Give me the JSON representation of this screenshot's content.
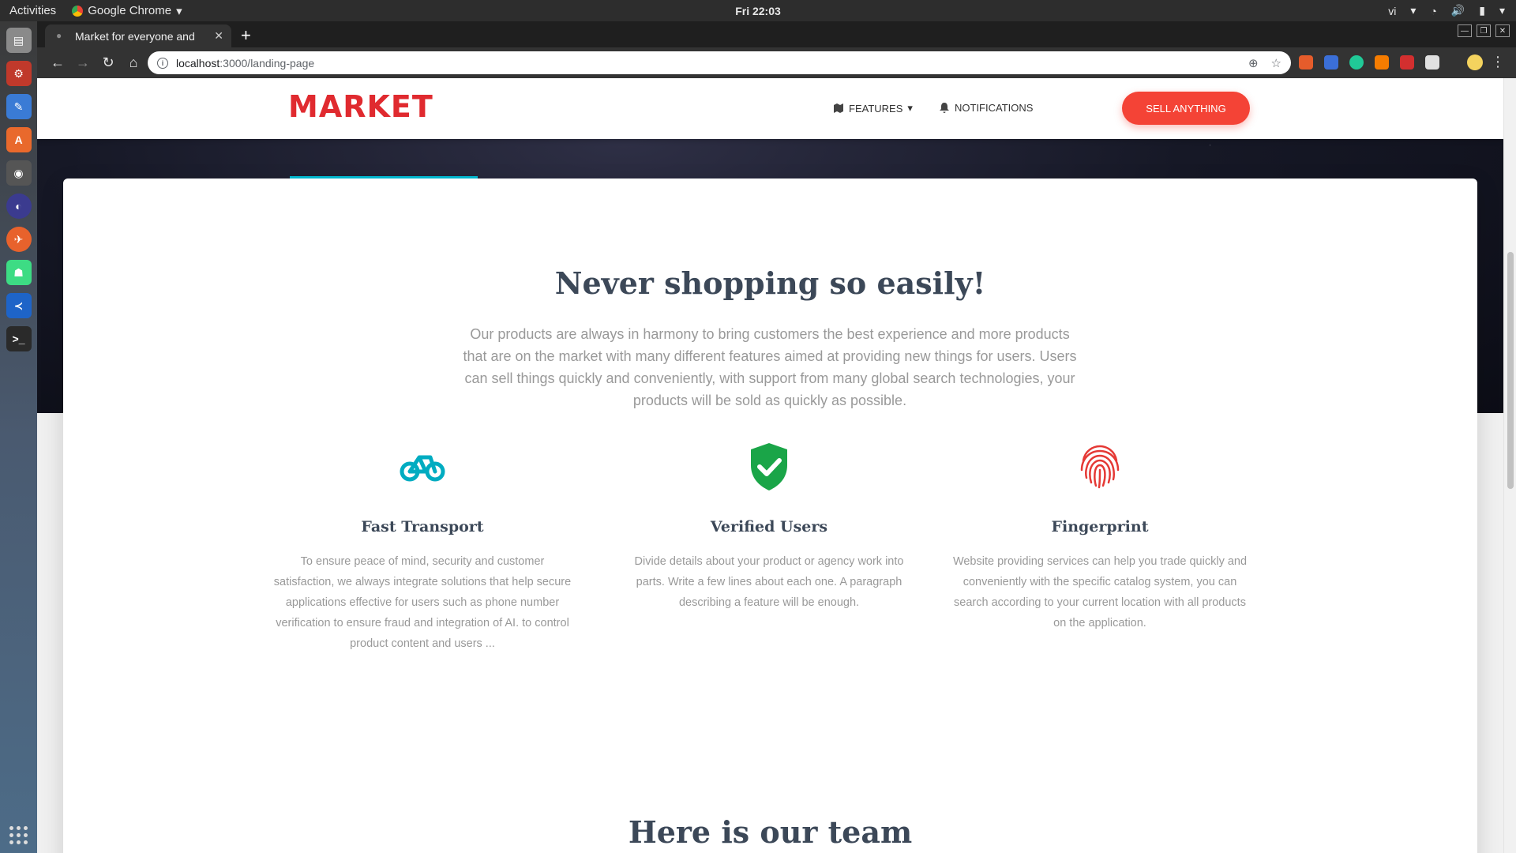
{
  "system": {
    "activities": "Activities",
    "app_name": "Google Chrome",
    "clock": "Fri 22:03",
    "lang": "vi"
  },
  "browser": {
    "tab_title": "Market for everyone and",
    "url_host": "localhost",
    "url_path": ":3000/landing-page"
  },
  "navbar": {
    "brand": "MARKET",
    "features": "FEATURES",
    "notifications": "NOTIFICATIONS",
    "sell": "SELL ANYTHING"
  },
  "section": {
    "title": "Never shopping so easily!",
    "description": "Our products are always in harmony to bring customers the best experience and more products that are on the market with many different features aimed at providing new things for users. Users can sell things quickly and conveniently, with support from many global search technologies, your products will be sold as quickly as possible."
  },
  "features": [
    {
      "icon": "bike-icon",
      "color": "#00acc1",
      "title": "Fast Transport",
      "text": "To ensure peace of mind, security and customer satisfaction, we always integrate solutions that help secure applications effective for users such as phone number verification to ensure fraud and integration of AI. to control product content and users ..."
    },
    {
      "icon": "verified-shield-icon",
      "color": "#1aa548",
      "title": "Verified Users",
      "text": "Divide details about your product or agency work into parts. Write a few lines about each one. A paragraph describing a feature will be enough."
    },
    {
      "icon": "fingerprint-icon",
      "color": "#e53935",
      "title": "Fingerprint",
      "text": "Website providing services can help you trade quickly and conveniently with the specific catalog system, you can search according to your current location with all products on the application."
    }
  ],
  "team": {
    "title": "Here is our team"
  }
}
